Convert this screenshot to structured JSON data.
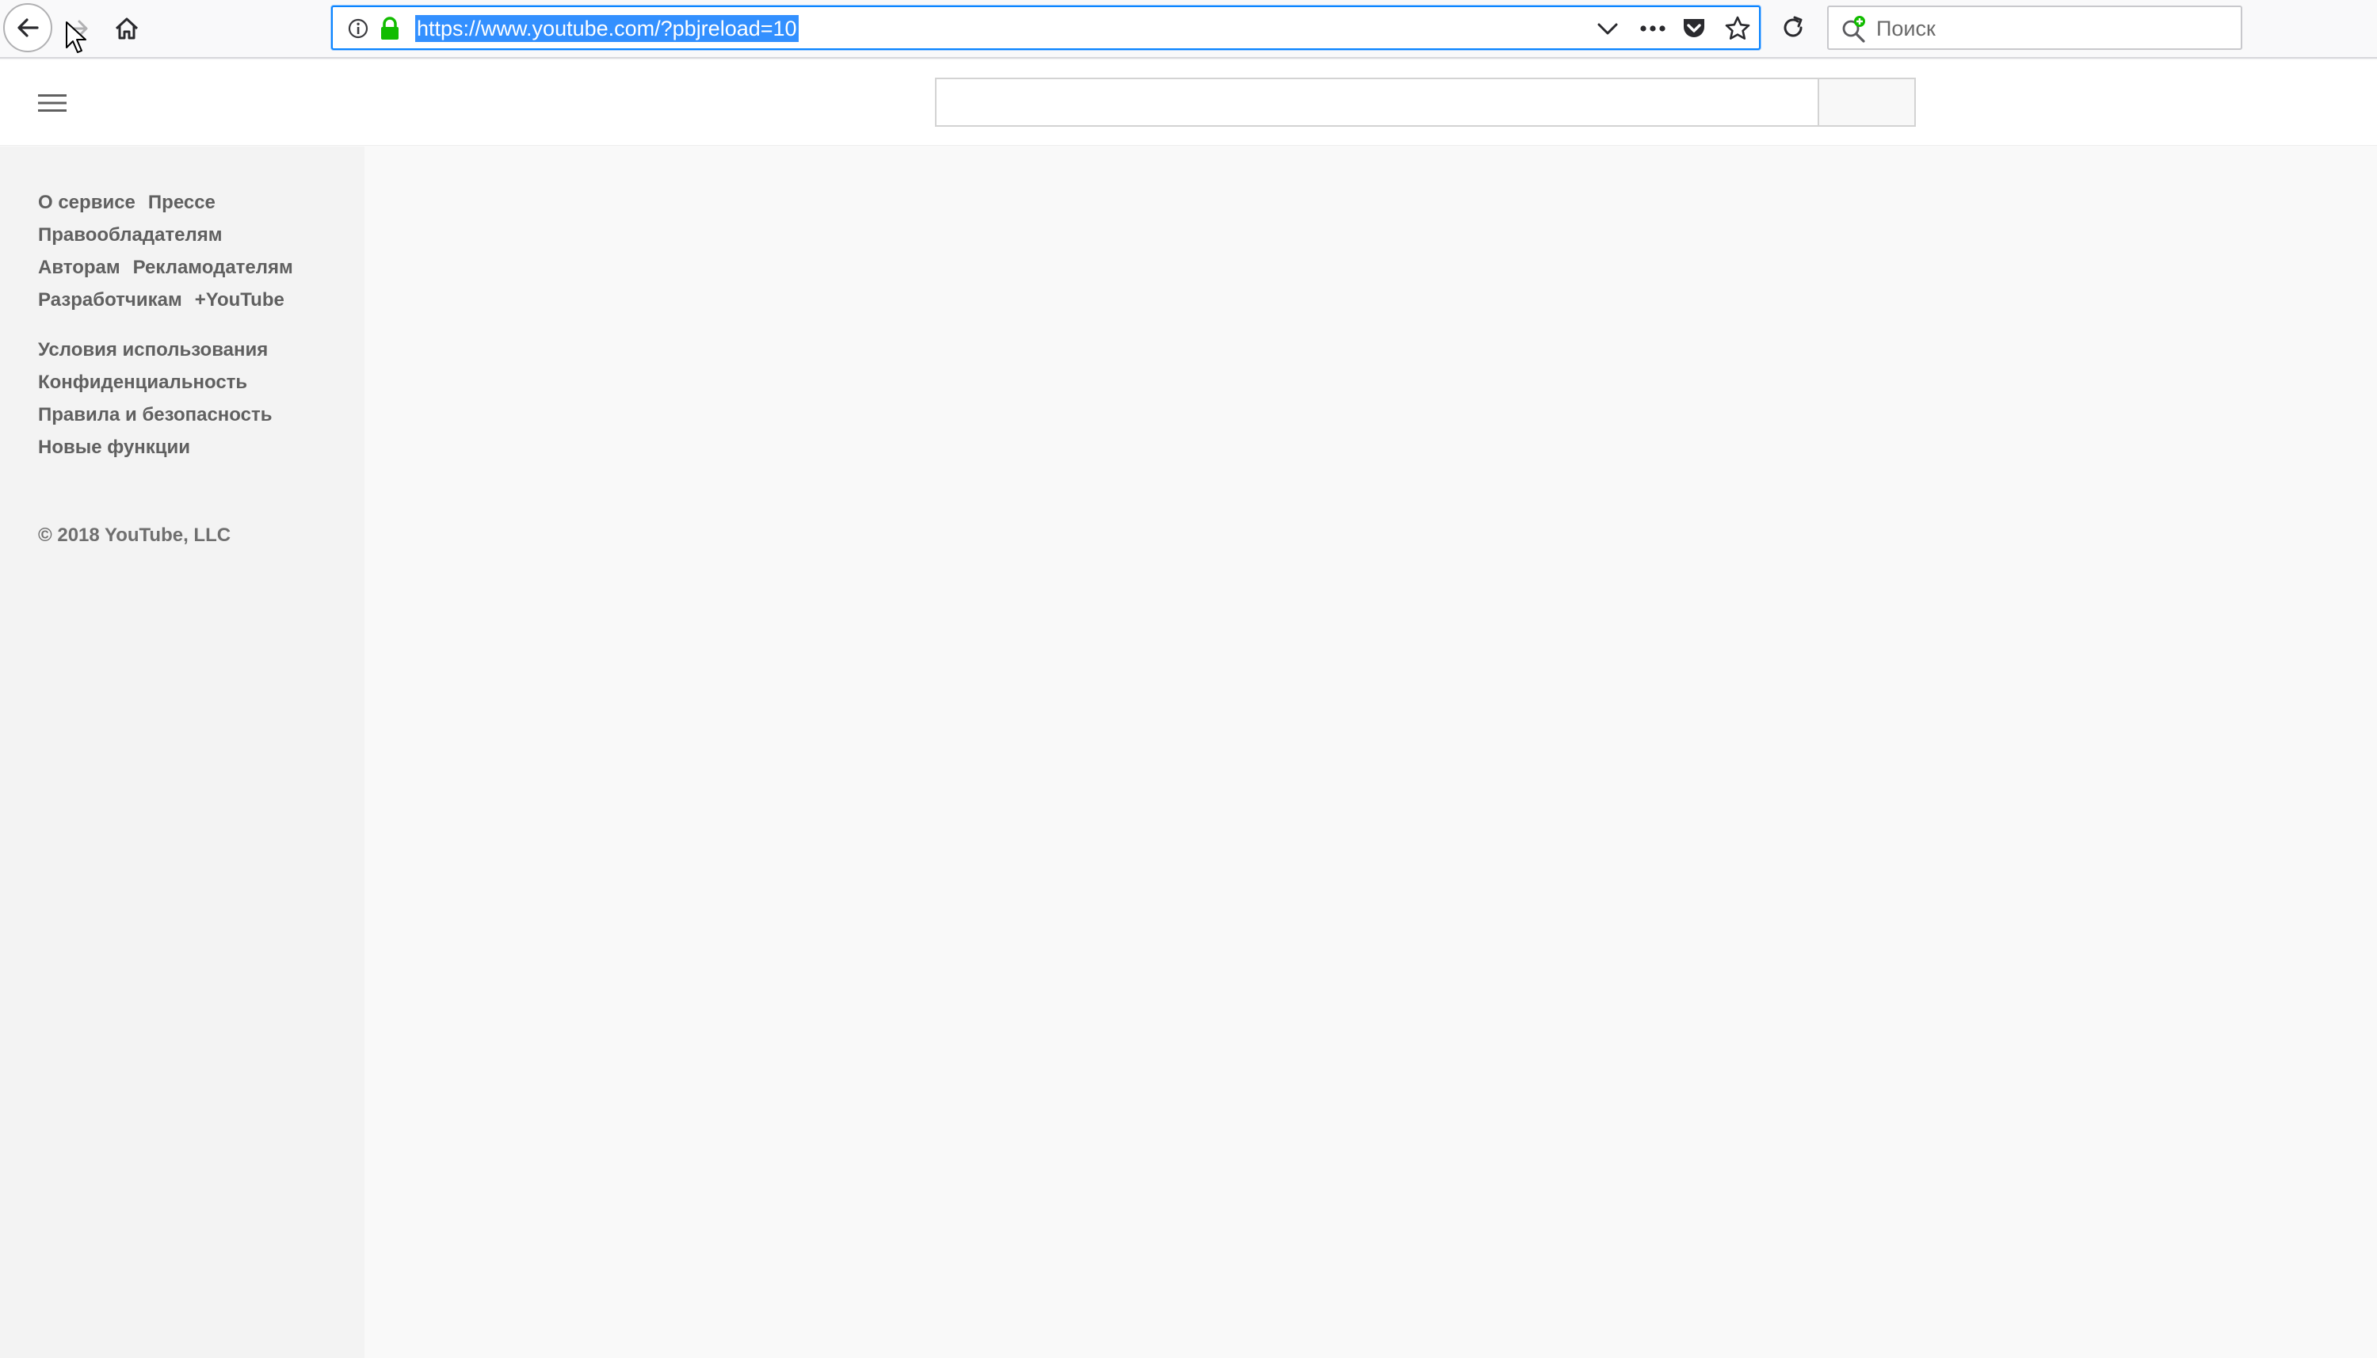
{
  "browser": {
    "url": "https://www.youtube.com/?pbjreload=10",
    "search_placeholder": "Поиск",
    "icons": {
      "back": "back-arrow-icon",
      "forward": "forward-arrow-icon",
      "home": "home-icon",
      "info": "info-icon",
      "lock": "lock-icon",
      "dropdown": "chevron-down-icon",
      "more": "more-dots-icon",
      "pocket": "pocket-icon",
      "bookmark": "star-icon",
      "reload": "reload-icon",
      "search": "search-glass-icon"
    },
    "accent_color": "#0a84ff",
    "lock_color": "#12bc00"
  },
  "youtube": {
    "header": {
      "menu_icon": "hamburger-menu-icon",
      "search_value": ""
    },
    "sidebar": {
      "link_rows": [
        [
          "О сервисе",
          "Прессе"
        ],
        [
          "Правообладателям"
        ],
        [
          "Авторам",
          "Рекламодателям"
        ],
        [
          "Разработчикам",
          "+YouTube"
        ]
      ],
      "policy_links": [
        "Условия использования",
        "Конфиденциальность",
        "Правила и безопасность",
        "Новые функции"
      ],
      "copyright": "© 2018 YouTube, LLC"
    }
  }
}
